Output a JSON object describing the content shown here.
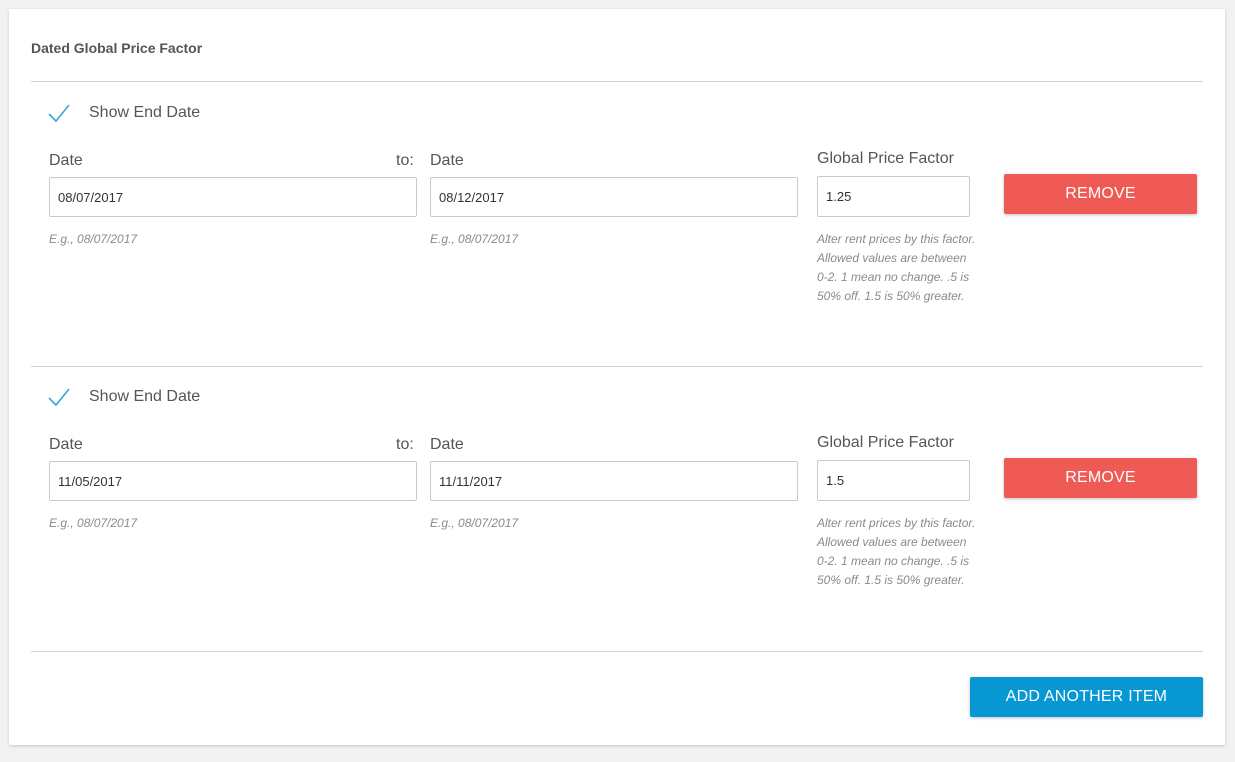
{
  "section": {
    "title": "Dated Global Price Factor"
  },
  "colors": {
    "accent": "#0798d3",
    "danger": "#f05a55",
    "check": "#39a8d8"
  },
  "items": [
    {
      "show_end_date_label": "Show End Date",
      "show_end_date_checked": true,
      "start_date_label": "Date",
      "to_label": "to:",
      "end_date_label": "Date",
      "start_date_value": "08/07/2017",
      "end_date_value": "08/12/2017",
      "start_date_hint": "E.g., 08/07/2017",
      "end_date_hint": "E.g., 08/07/2017",
      "factor_label": "Global Price Factor",
      "factor_value": "1.25",
      "factor_hint_1": "Alter rent prices by this factor.",
      "factor_hint_2": "Allowed values are between",
      "factor_hint_3": "0-2. 1 mean no change. .5 is",
      "factor_hint_4": "50% off. 1.5 is 50% greater.",
      "remove_label": "REMOVE"
    },
    {
      "show_end_date_label": "Show End Date",
      "show_end_date_checked": true,
      "start_date_label": "Date",
      "to_label": "to:",
      "end_date_label": "Date",
      "start_date_value": "11/05/2017",
      "end_date_value": "11/11/2017",
      "start_date_hint": "E.g., 08/07/2017",
      "end_date_hint": "E.g., 08/07/2017",
      "factor_label": "Global Price Factor",
      "factor_value": "1.5",
      "factor_hint_1": "Alter rent prices by this factor.",
      "factor_hint_2": "Allowed values are between",
      "factor_hint_3": "0-2. 1 mean no change. .5 is",
      "factor_hint_4": "50% off. 1.5 is 50% greater.",
      "remove_label": "REMOVE"
    }
  ],
  "footer": {
    "add_label": "ADD ANOTHER ITEM"
  }
}
